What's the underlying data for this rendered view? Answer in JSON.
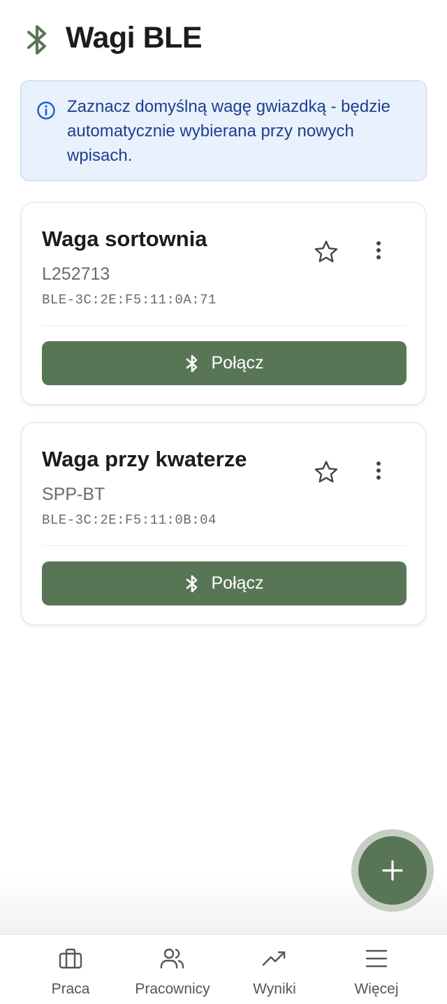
{
  "header": {
    "title": "Wagi BLE",
    "icon": "bluetooth-icon"
  },
  "info": {
    "icon": "info-icon",
    "text": "Zaznacz domyślną wagę gwiazdką - będzie automatycznie wybierana przy nowych wpisach."
  },
  "devices": [
    {
      "name": "Waga sortownia",
      "model": "L252713",
      "mac": "BLE-3C:2E:F5:11:0A:71",
      "connect_label": "Połącz"
    },
    {
      "name": "Waga przy kwaterze",
      "model": "SPP-BT",
      "mac": "BLE-3C:2E:F5:11:0B:04",
      "connect_label": "Połącz"
    }
  ],
  "fab": {
    "icon": "plus-icon"
  },
  "nav": [
    {
      "label": "Praca",
      "icon": "briefcase-icon"
    },
    {
      "label": "Pracownicy",
      "icon": "users-icon"
    },
    {
      "label": "Wyniki",
      "icon": "trending-up-icon"
    },
    {
      "label": "Więcej",
      "icon": "menu-icon"
    }
  ],
  "colors": {
    "primary": "#587656",
    "info_bg": "#e8f1fc",
    "info_border": "#bcd6f5",
    "info_text": "#1e3f8f"
  }
}
